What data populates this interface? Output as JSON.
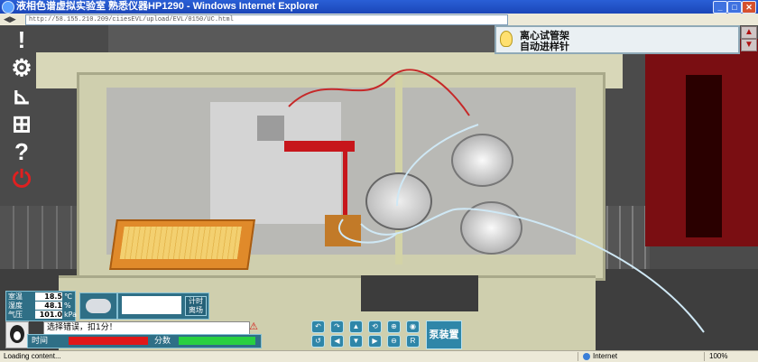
{
  "window": {
    "title": "液相色谱虚拟实验室 熟悉仪器HP1290 - Windows Internet Explorer",
    "minimize_icon": "_",
    "maximize_icon": "□",
    "close_icon": "✕"
  },
  "address": {
    "url": "http://58.155.210.209/ciiesEVL/upload/EVL/0150/UC.html"
  },
  "toolbar": {
    "items": [
      {
        "icon": "exclamation-icon",
        "glyph": "!"
      },
      {
        "icon": "gear-icon",
        "glyph": "⚙"
      },
      {
        "icon": "chart-icon",
        "glyph": "⊾"
      },
      {
        "icon": "grid-icon",
        "glyph": "⊞"
      },
      {
        "icon": "help-icon",
        "glyph": "?"
      },
      {
        "icon": "power-icon",
        "glyph": "⏻"
      }
    ]
  },
  "info": {
    "line1": "离心试管架",
    "line2": "自动进样针",
    "scroll_up": "▲",
    "scroll_down": "▼"
  },
  "env": {
    "temp_label": "室温",
    "temp_value": "18.5",
    "temp_unit": "℃",
    "humidity_label": "湿度",
    "humidity_value": "48.1",
    "humidity_unit": "%",
    "pressure_label": "气压",
    "pressure_value": "101.0",
    "pressure_unit": "kPa"
  },
  "timer": {
    "button_label": "计时 离场"
  },
  "message": {
    "text": "选择错误，扣1分！",
    "warn_icon": "⚠"
  },
  "bars": {
    "time_label": "时间",
    "score_label": "分数"
  },
  "controls": {
    "row1": [
      "↶",
      "↷",
      "▲",
      "⟲",
      "⊕",
      "◉"
    ],
    "row2": [
      "↺",
      "◀",
      "▼",
      "▶",
      "⊖",
      "R"
    ]
  },
  "pump_button": "泵装置",
  "status": {
    "left": "Loading content...",
    "zone": "Internet",
    "zoom": "100%"
  },
  "colors": {
    "titlebar": "#1b46b8",
    "panel": "#2f6f86",
    "time_bar": "#e01818",
    "score_bar": "#28d040",
    "cabinet": "#cfcfae"
  }
}
